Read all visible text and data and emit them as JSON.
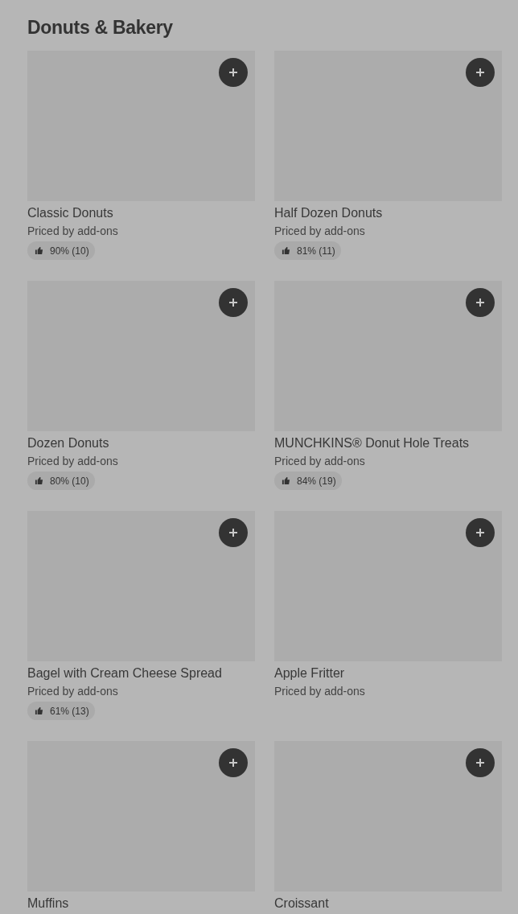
{
  "section": {
    "title": "Donuts & Bakery"
  },
  "items": [
    {
      "name": "Classic Donuts",
      "price": "Priced by add-ons",
      "rating": "90% (10)"
    },
    {
      "name": "Half Dozen Donuts",
      "price": "Priced by add-ons",
      "rating": "81% (11)"
    },
    {
      "name": "Dozen Donuts",
      "price": "Priced by add-ons",
      "rating": "80% (10)"
    },
    {
      "name": "MUNCHKINS® Donut Hole Treats",
      "price": "Priced by add-ons",
      "rating": "84% (19)"
    },
    {
      "name": "Bagel with Cream Cheese Spread",
      "price": "Priced by add-ons",
      "rating": "61% (13)"
    },
    {
      "name": "Apple Fritter",
      "price": "Priced by add-ons"
    },
    {
      "name": "Muffins"
    },
    {
      "name": "Croissant"
    }
  ]
}
